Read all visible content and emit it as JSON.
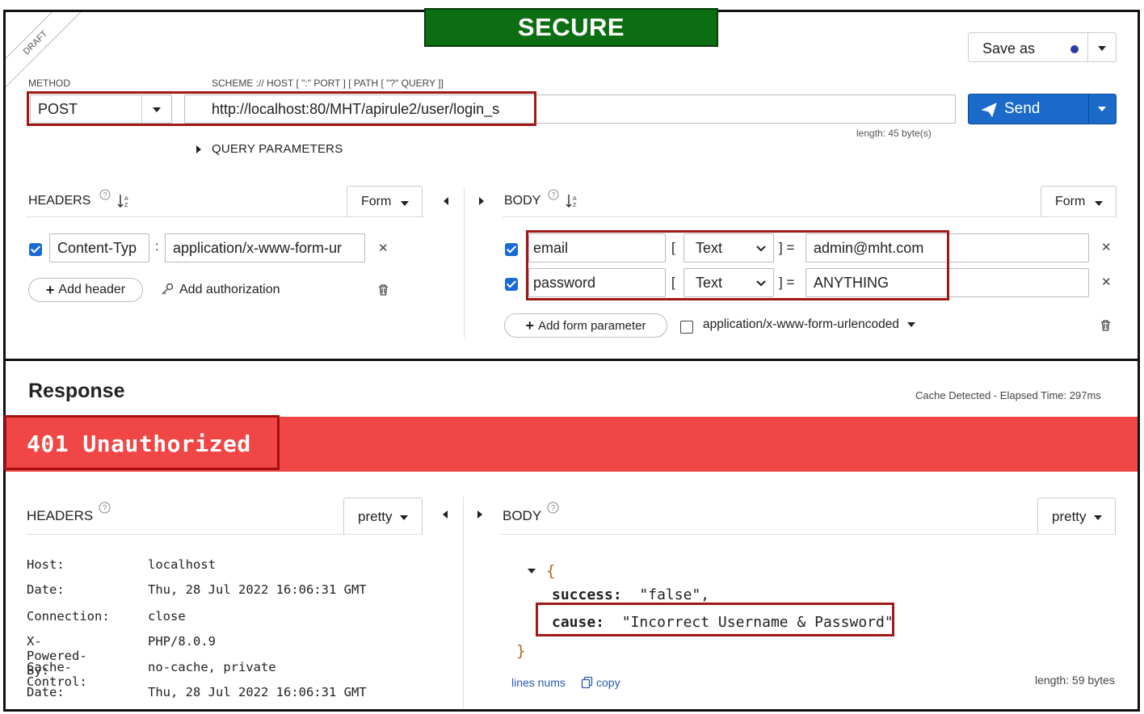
{
  "banner": {
    "secure": "SECURE",
    "draft": "DRAFT"
  },
  "request": {
    "save_as": "Save as",
    "method_label": "METHOD",
    "url_label": "SCHEME :// HOST [ \":\" PORT ] [ PATH [ \"?\" QUERY ]]",
    "method": "POST",
    "url": "http://localhost:80/MHT/apirule2/user/login_s",
    "length": "length: 45 byte(s)",
    "send": "Send",
    "query_params": "QUERY PARAMETERS",
    "headers_title": "HEADERS",
    "headers_mode": "Form",
    "headers": [
      {
        "name": "Content-Typ",
        "value": "application/x-www-form-ur"
      }
    ],
    "add_header": "Add header",
    "add_authorization": "Add authorization",
    "body_title": "BODY",
    "body_mode": "Form",
    "body_params": [
      {
        "name": "email",
        "type": "Text",
        "value": "admin@mht.com"
      },
      {
        "name": "password",
        "type": "Text",
        "value": "ANYTHING"
      }
    ],
    "add_form_param": "Add form parameter",
    "content_type": "application/x-www-form-urlencoded"
  },
  "response": {
    "title": "Response",
    "cache_info": "Cache Detected - Elapsed Time: 297ms",
    "status": "401 Unauthorized",
    "headers_title": "HEADERS",
    "headers_mode": "pretty",
    "body_title": "BODY",
    "body_mode": "pretty",
    "headers": [
      {
        "key": "Host:",
        "value": "localhost"
      },
      {
        "key": "Date:",
        "value": "Thu, 28 Jul 2022 16:06:31 GMT"
      },
      {
        "key": "Connection:",
        "value": "close"
      },
      {
        "key": "X-Powered-By:",
        "value": "PHP/8.0.9"
      },
      {
        "key": "Cache-Control:",
        "value": "no-cache, private"
      },
      {
        "key": "Date:",
        "value": "Thu, 28 Jul 2022 16:06:31 GMT"
      }
    ],
    "json": {
      "open": "{",
      "close": "}",
      "success_key": "success:",
      "success_val": "\"false\",",
      "cause_key": "cause:",
      "cause_val": "\"Incorrect Username & Password\""
    },
    "lines_nums": "lines nums",
    "copy": "copy",
    "length": "length: 59 bytes"
  },
  "colors": {
    "secure_green": "#0b6e12",
    "error_red": "#f04646",
    "highlight_red": "#a01818",
    "send_blue": "#1b6ac9"
  }
}
